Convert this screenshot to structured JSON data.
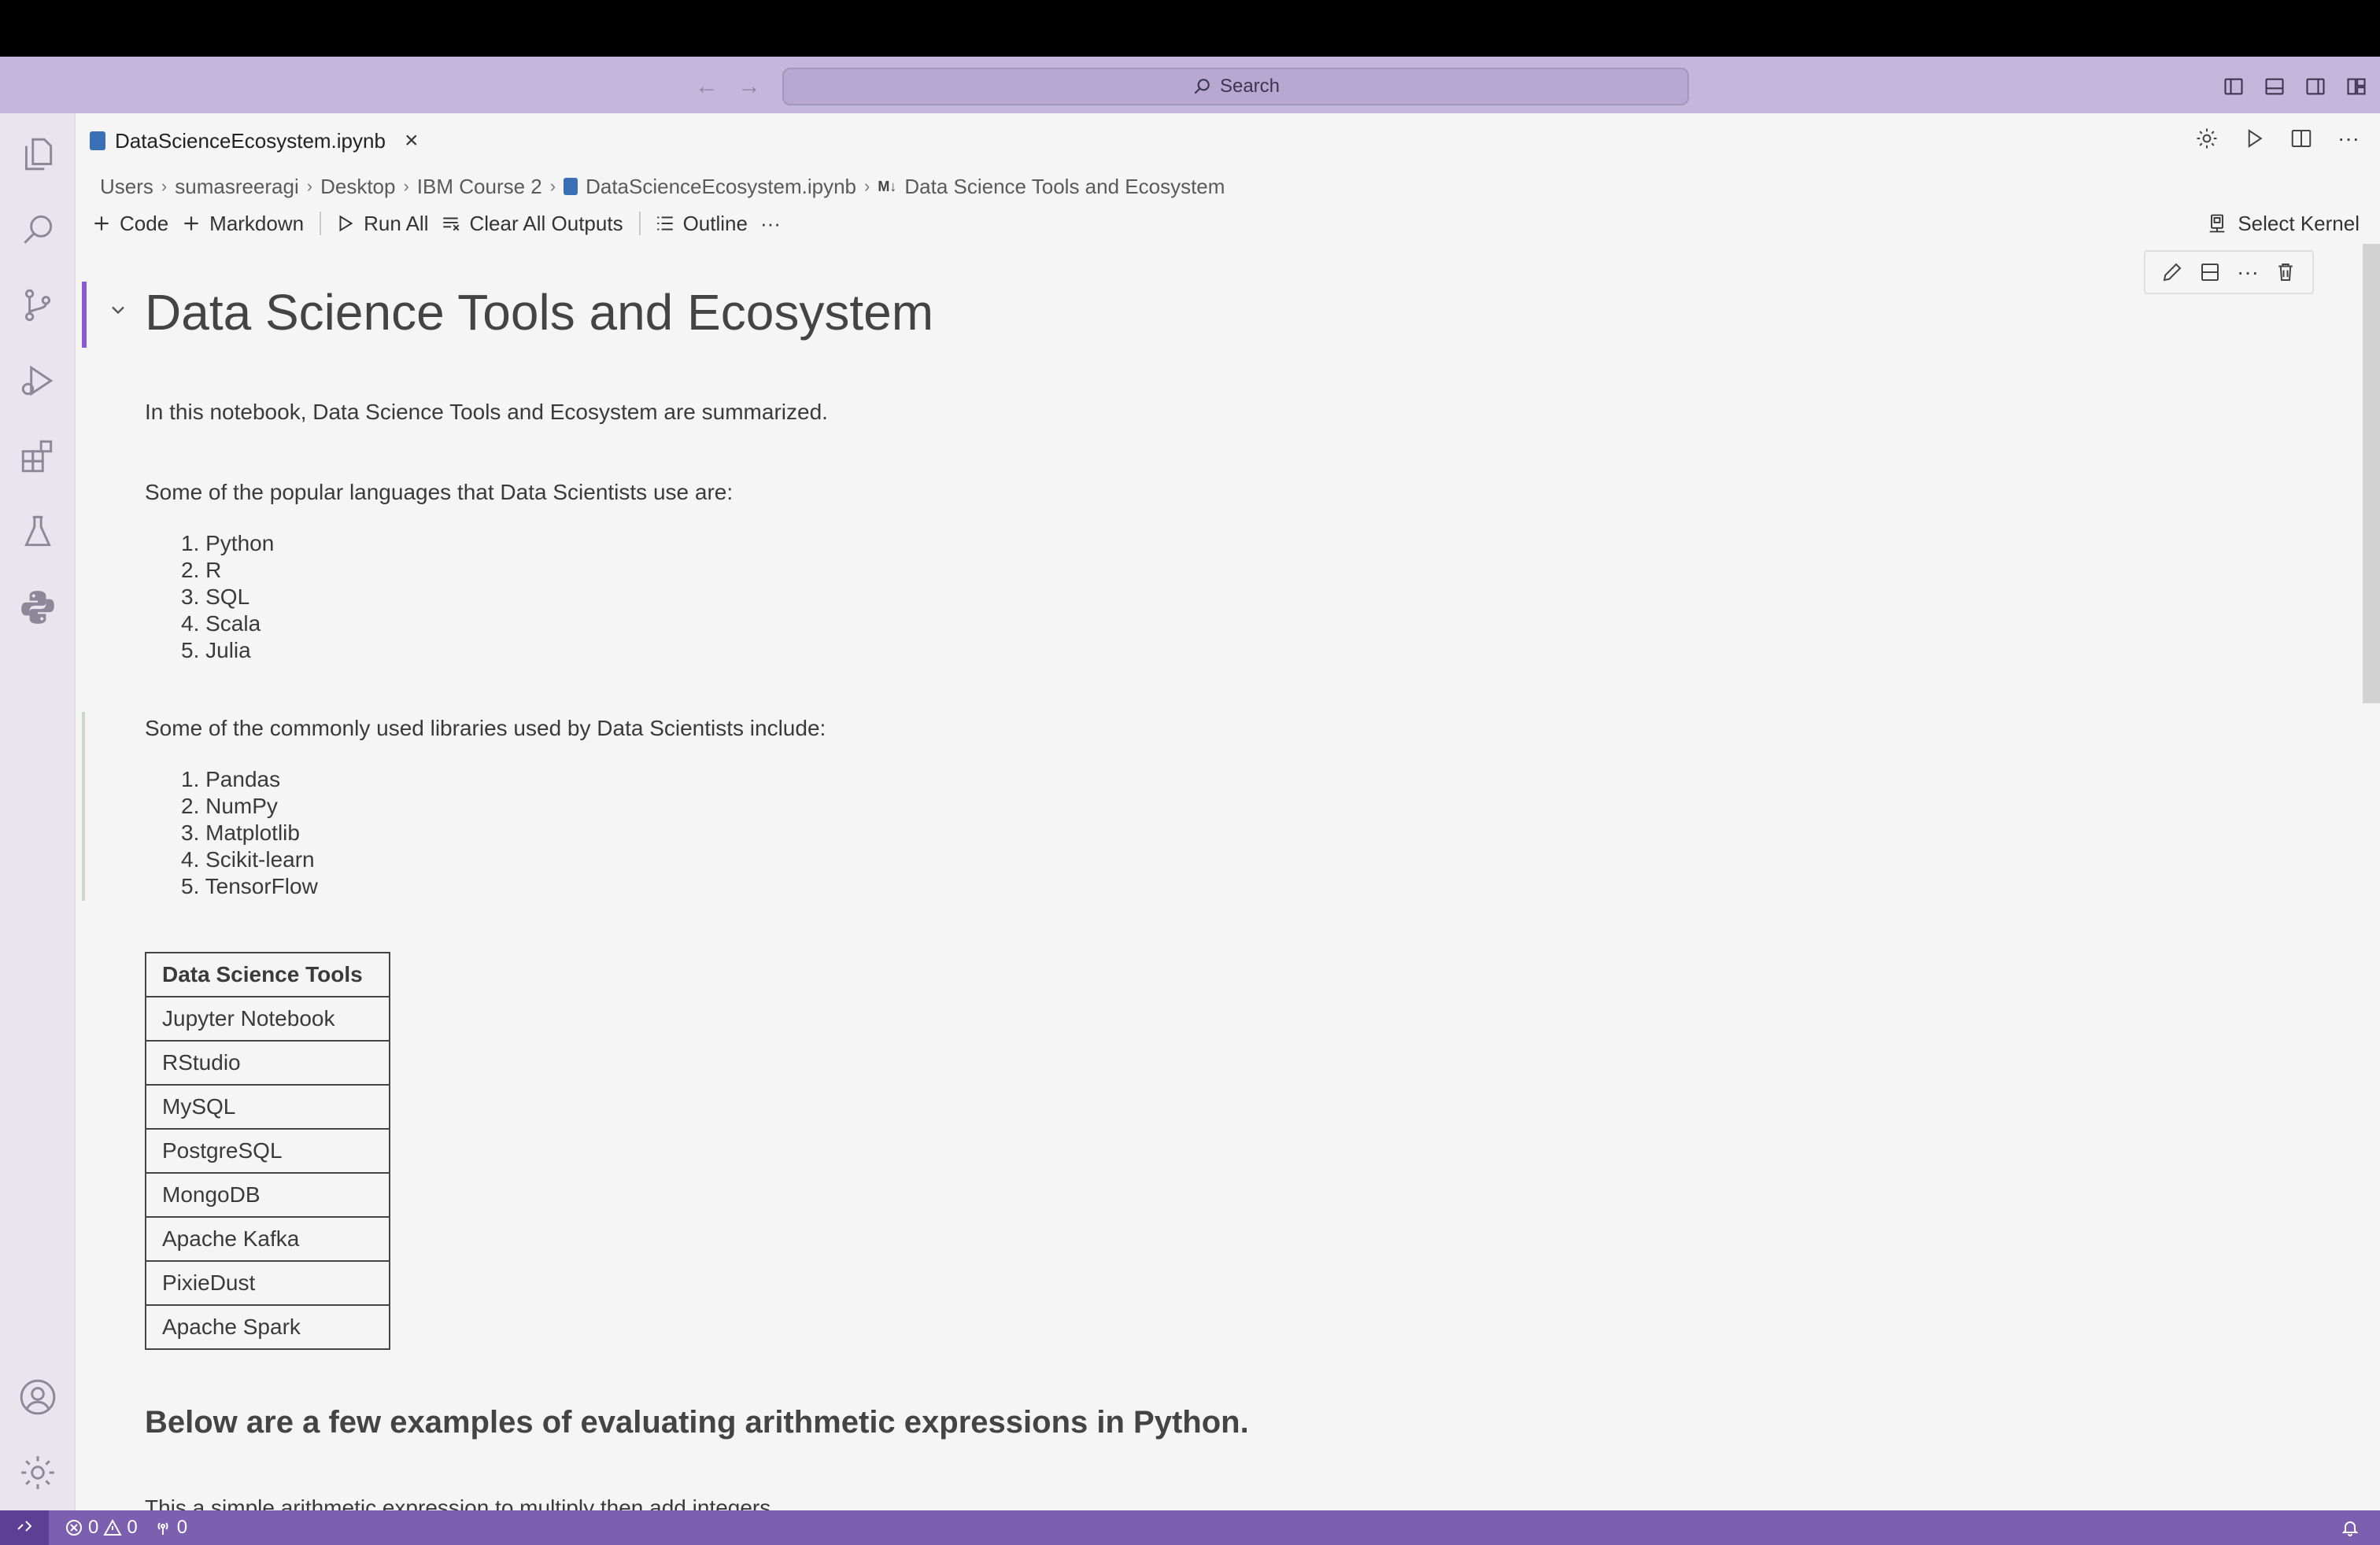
{
  "titlebar": {
    "search_label": "Search",
    "back_icon": "arrow-left-icon",
    "forward_icon": "arrow-right-icon"
  },
  "activitybar": {
    "items": [
      "explorer-icon",
      "search-icon",
      "source-control-icon",
      "run-debug-icon",
      "extensions-icon",
      "testing-icon",
      "python-icon"
    ],
    "bottom": [
      "account-icon",
      "manage-gear-icon"
    ]
  },
  "tab": {
    "filename": "DataScienceEcosystem.ipynb",
    "close": "×"
  },
  "breadcrumb": {
    "parts": [
      "Users",
      "sumasreeragi",
      "Desktop",
      "IBM Course 2",
      "DataScienceEcosystem.ipynb"
    ],
    "md_badge": "M↓",
    "section": "Data Science Tools and Ecosystem"
  },
  "toolbar": {
    "code": "Code",
    "markdown": "Markdown",
    "run_all": "Run All",
    "clear_outputs": "Clear All Outputs",
    "outline": "Outline",
    "more": "···",
    "select_kernel": "Select Kernel"
  },
  "notebook": {
    "title": "Data Science Tools and Ecosystem",
    "intro": "In this notebook, Data Science Tools and Ecosystem are summarized.",
    "languages_intro": "Some of the popular languages that Data Scientists use are:",
    "languages": [
      "1. Python",
      "2. R",
      "3. SQL",
      "4. Scala",
      "5. Julia"
    ],
    "libraries_intro": "Some of the commonly used libraries used by Data Scientists include:",
    "libraries": [
      "1. Pandas",
      "2. NumPy",
      "3. Matplotlib",
      "4. Scikit-learn",
      "5. TensorFlow"
    ],
    "tools_header": "Data Science Tools",
    "tools": [
      "Jupyter Notebook",
      "RStudio",
      "MySQL",
      "PostgreSQL",
      "MongoDB",
      "Apache Kafka",
      "PixieDust",
      "Apache Spark"
    ],
    "arith_heading": "Below are a few examples of evaluating arithmetic expressions in Python.",
    "arith_partial": "This a simple arithmetic expression to multiply then add integers"
  },
  "statusbar": {
    "errors": "0",
    "warnings": "0",
    "ports": "0"
  },
  "colors": {
    "titlebar": "#c4b7dc",
    "statusbar": "#7c5fae",
    "active_cell": "#8a5ad0"
  }
}
